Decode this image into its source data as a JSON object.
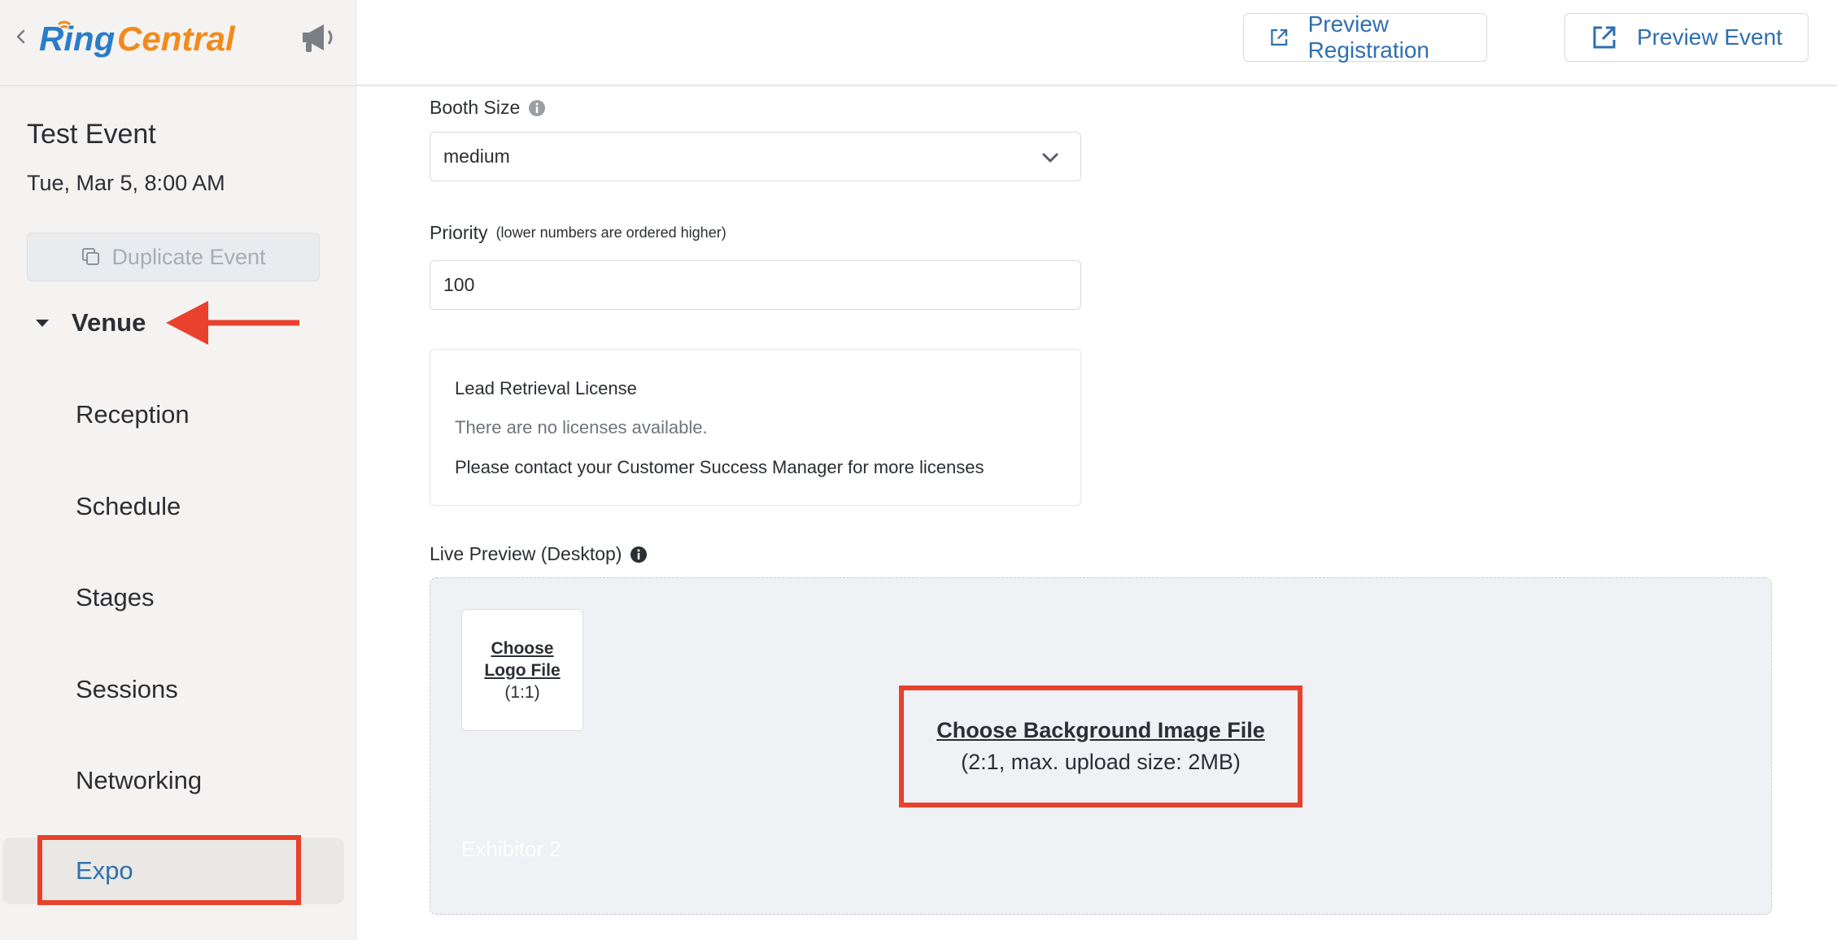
{
  "sidebar": {
    "event_title": "Test Event",
    "event_date": "Tue, Mar 5, 8:00 AM",
    "duplicate_label": "Duplicate Event",
    "venue_label": "Venue",
    "nav": {
      "reception": "Reception",
      "schedule": "Schedule",
      "stages": "Stages",
      "sessions": "Sessions",
      "networking": "Networking",
      "expo": "Expo"
    }
  },
  "header": {
    "preview_registration": "Preview Registration",
    "preview_event": "Preview Event"
  },
  "form": {
    "booth_size_label": "Booth Size",
    "booth_size_value": "medium",
    "priority_label": "Priority",
    "priority_hint": "(lower numbers are ordered higher)",
    "priority_value": "100",
    "license": {
      "title": "Lead Retrieval License",
      "none": "There are no licenses available.",
      "contact": "Please contact your Customer Success Manager for more licenses"
    },
    "live_preview_label": "Live Preview (Desktop)",
    "preview": {
      "logo_choose_line1": "Choose",
      "logo_choose_line2": "Logo File",
      "logo_ratio": "(1:1)",
      "bg_choose": "Choose Background Image File",
      "bg_size": "(2:1, max. upload size: 2MB)",
      "exhibitor_name": "Exhibitor 2"
    }
  },
  "colors": {
    "accent_blue": "#2f6fb0",
    "annotation_red": "#e8412d",
    "sidebar_bg": "#f4f3f1"
  },
  "logo": {
    "text_ring": "Ring",
    "text_central": "Central"
  }
}
